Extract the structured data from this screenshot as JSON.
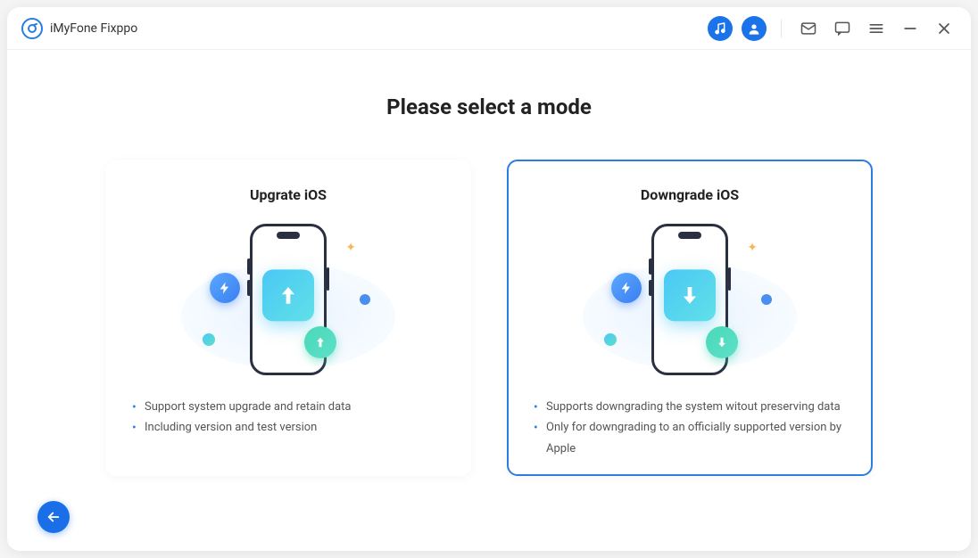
{
  "app": {
    "title": "iMyFone Fixppo"
  },
  "page": {
    "heading": "Please select a mode"
  },
  "modes": {
    "upgrade": {
      "title": "Upgrate iOS",
      "bullet1": "Support system upgrade and retain data",
      "bullet2": "Including version and test version"
    },
    "downgrade": {
      "title": "Downgrade iOS",
      "bullet1": "Supports downgrading the system witout preserving data",
      "bullet2": "Only for downgrading to an officially supported version by Apple"
    }
  },
  "state": {
    "selected": "downgrade"
  }
}
